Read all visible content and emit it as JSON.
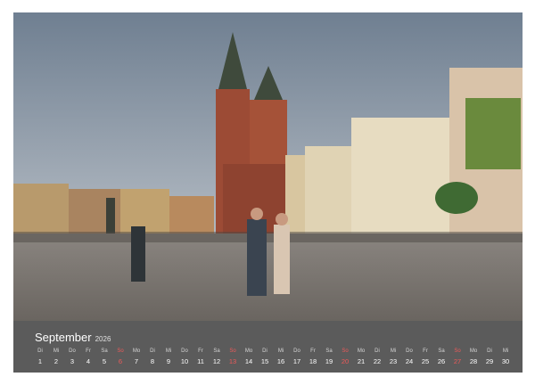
{
  "photo": {
    "alt_subject": "market-square-with-church-towers",
    "colors": {
      "sky": "#8a97a6",
      "brick": "#9c4b35",
      "pavement": "#7f7b77"
    }
  },
  "calendar": {
    "month": "September",
    "year": "2026",
    "highlight_color": "#ee5a5a",
    "days": [
      {
        "name": "Di",
        "num": "1",
        "highlight": false
      },
      {
        "name": "Mi",
        "num": "2",
        "highlight": false
      },
      {
        "name": "Do",
        "num": "3",
        "highlight": false
      },
      {
        "name": "Fr",
        "num": "4",
        "highlight": false
      },
      {
        "name": "Sa",
        "num": "5",
        "highlight": false
      },
      {
        "name": "So",
        "num": "6",
        "highlight": true
      },
      {
        "name": "Mo",
        "num": "7",
        "highlight": false
      },
      {
        "name": "Di",
        "num": "8",
        "highlight": false
      },
      {
        "name": "Mi",
        "num": "9",
        "highlight": false
      },
      {
        "name": "Do",
        "num": "10",
        "highlight": false
      },
      {
        "name": "Fr",
        "num": "11",
        "highlight": false
      },
      {
        "name": "Sa",
        "num": "12",
        "highlight": false
      },
      {
        "name": "So",
        "num": "13",
        "highlight": true
      },
      {
        "name": "Mo",
        "num": "14",
        "highlight": false
      },
      {
        "name": "Di",
        "num": "15",
        "highlight": false
      },
      {
        "name": "Mi",
        "num": "16",
        "highlight": false
      },
      {
        "name": "Do",
        "num": "17",
        "highlight": false
      },
      {
        "name": "Fr",
        "num": "18",
        "highlight": false
      },
      {
        "name": "Sa",
        "num": "19",
        "highlight": false
      },
      {
        "name": "So",
        "num": "20",
        "highlight": true
      },
      {
        "name": "Mo",
        "num": "21",
        "highlight": false
      },
      {
        "name": "Di",
        "num": "22",
        "highlight": false
      },
      {
        "name": "Mi",
        "num": "23",
        "highlight": false
      },
      {
        "name": "Do",
        "num": "24",
        "highlight": false
      },
      {
        "name": "Fr",
        "num": "25",
        "highlight": false
      },
      {
        "name": "Sa",
        "num": "26",
        "highlight": false
      },
      {
        "name": "So",
        "num": "27",
        "highlight": true
      },
      {
        "name": "Mo",
        "num": "28",
        "highlight": false
      },
      {
        "name": "Di",
        "num": "29",
        "highlight": false
      },
      {
        "name": "Mi",
        "num": "30",
        "highlight": false
      }
    ]
  }
}
